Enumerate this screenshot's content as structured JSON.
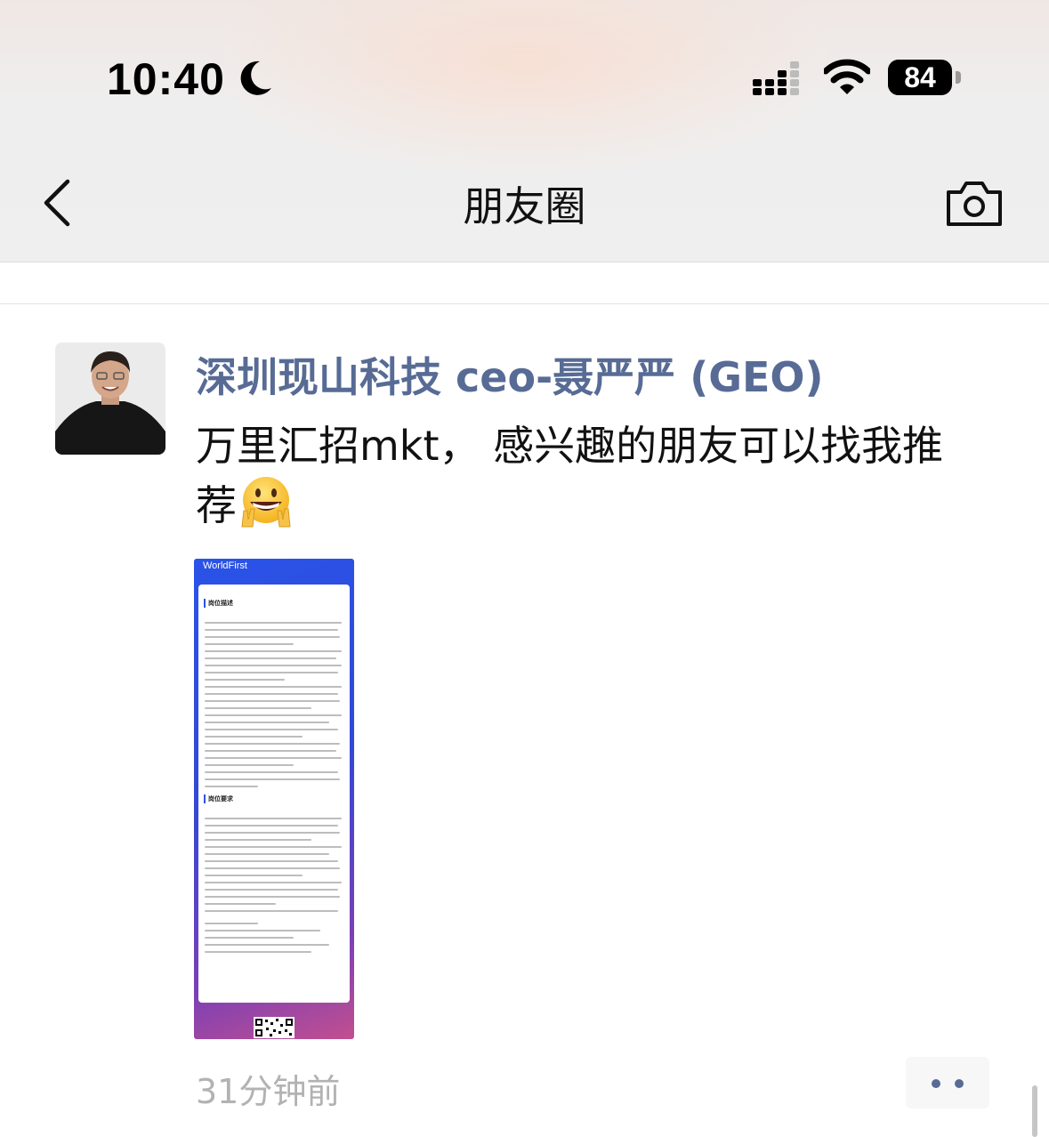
{
  "status_bar": {
    "time": "10:40",
    "battery": "84",
    "battery_level_percent": 84,
    "icons": [
      "moon-icon",
      "signal-icon",
      "wifi-icon",
      "battery-icon"
    ]
  },
  "nav": {
    "title": "朋友圈",
    "back_icon": "chevron-left-icon",
    "camera_icon": "camera-icon"
  },
  "post": {
    "author": "深圳现山科技 ceo-聂严严 (GEO)",
    "text": "万里汇招mkt， 感兴趣的朋友可以找我推荐",
    "emoji": "grinning-face-victory-hand-emoji",
    "image": {
      "brand": "WorldFirst",
      "section1": "岗位描述",
      "section2": "岗位要求"
    },
    "timestamp": "31分钟前",
    "more_icon": "more-dots-icon"
  },
  "colors": {
    "name_link": "#576b95",
    "timestamp": "#b2b2b2",
    "nav_bg": "#efefef"
  }
}
